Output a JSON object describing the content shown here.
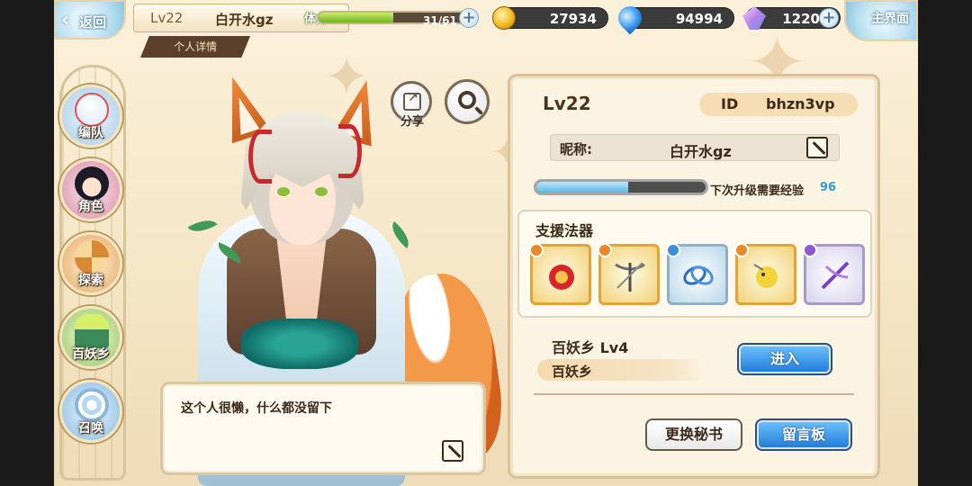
{
  "topbar": {
    "back_label": "返回",
    "player_level": "Lv22",
    "player_name": "白开水gz",
    "tab_label": "个人详情",
    "stamina_label": "体力",
    "stamina_text": "31/61",
    "stamina_fraction": 0.508,
    "gold": "27934",
    "spirit": "94994",
    "crystal": "1220",
    "home_label": "主界面"
  },
  "left_nav": {
    "items": [
      {
        "label": "编队",
        "icon": "team-icon"
      },
      {
        "label": "角色",
        "icon": "character-icon"
      },
      {
        "label": "探索",
        "icon": "explore-icon"
      },
      {
        "label": "百妖乡",
        "icon": "village-icon"
      },
      {
        "label": "召唤",
        "icon": "summon-icon"
      }
    ]
  },
  "character": {
    "share_label": "分享"
  },
  "signature": {
    "text": "这个人很懒，什么都没留下"
  },
  "profile": {
    "level": "Lv22",
    "id_label": "ID",
    "id_value": "bhzn3vp",
    "nickname_label": "昵称:",
    "nickname_value": "白开水gz",
    "exp_label": "下次升级需要经验",
    "exp_value": "96",
    "exp_fraction": 0.54,
    "support_title": "支援法器",
    "support_items": [
      {
        "name": "red-dragon-artifact",
        "rarity_color": "#e8872c"
      },
      {
        "name": "crossbow-artifact",
        "rarity_color": "#e8872c"
      },
      {
        "name": "blue-rope-artifact",
        "rarity_color": "#3f8fd8"
      },
      {
        "name": "yellow-bird-artifact",
        "rarity_color": "#e8872c"
      },
      {
        "name": "purple-crossbow-artifact",
        "rarity_color": "#8a5ad0"
      }
    ],
    "village_title": "百妖乡  Lv4",
    "village_name": "百妖乡",
    "enter_label": "进入",
    "secretary_label": "更换秘书",
    "message_board_label": "留言板"
  },
  "colors": {
    "accent_blue": "#1f78d6",
    "panel_bg": "#fbf4e3",
    "gold_border": "#d9c29a"
  }
}
